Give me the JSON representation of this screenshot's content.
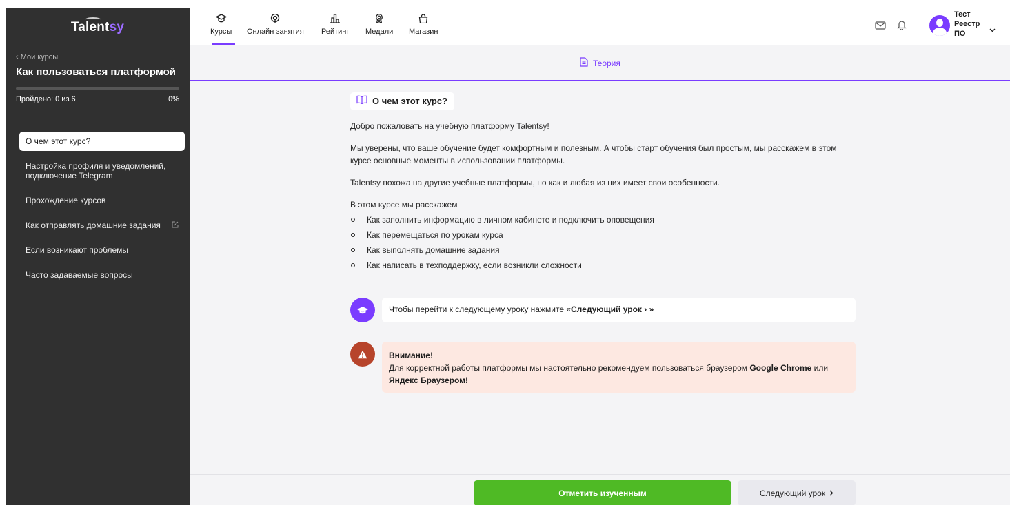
{
  "brand": {
    "logo_main": "Talent",
    "logo_accent": "sy"
  },
  "sidebar": {
    "back_label": "‹ Мои курсы",
    "course_title": "Как пользоваться платформой",
    "progress_label": "Пройдено: 0 из 6",
    "progress_percent_label": "0%",
    "progress_fraction": 0,
    "lessons": [
      {
        "label": "О чем этот курс?",
        "active": true
      },
      {
        "label": "Настройка профиля и уведомлений, подключение Telegram"
      },
      {
        "label": "Прохождение курсов"
      },
      {
        "label": "Как отправлять домашние задания",
        "icon": "edit-icon"
      },
      {
        "label": "Если возникают проблемы"
      },
      {
        "label": "Часто задаваемые вопросы"
      }
    ]
  },
  "nav": {
    "items": [
      {
        "label": "Курсы",
        "icon": "graduation-cap-icon",
        "active": true
      },
      {
        "label": "Онлайн занятия",
        "icon": "broadcast-icon"
      },
      {
        "label": "Рейтинг",
        "icon": "bar-chart-icon"
      },
      {
        "label": "Медали",
        "icon": "medal-icon"
      },
      {
        "label": "Магазин",
        "icon": "shopping-bag-icon"
      }
    ]
  },
  "user": {
    "name_line1": "Тест",
    "name_line2": "Реестр",
    "name_line3": "ПО"
  },
  "tabs": {
    "theory_label": "Теория"
  },
  "lesson": {
    "section_title": "О чем этот курс?",
    "paragraphs": [
      "Добро пожаловать на учебную платформу Talentsy!",
      "Мы уверены, что ваше обучение будет комфортным и полезным. А чтобы старт обучения был простым, мы расскажем в этом курсе основные моменты в использовании платформы.",
      "Talentsy похожа на другие учебные платформы, но как и любая из них имеет свои особенности.",
      "В этом курсе мы расскажем"
    ],
    "bullets": [
      "Как заполнить информацию в личном кабинете и подключить оповещения",
      "Как перемещаться по урокам курса",
      "Как выполнять домашние задания",
      "Как написать в техподдержку, если возникли сложности"
    ],
    "tip_prefix": "Чтобы перейти к следующему уроку нажмите ",
    "tip_bold": "«Следующий урок › »",
    "warning_title": "Внимание!",
    "warning_text_1": "Для корректной работы платформы мы настоятельно рекомендуем пользоваться браузером ",
    "warning_bold_1": "Google Chrome",
    "warning_text_2": " или ",
    "warning_bold_2": "Яндекс Браузером",
    "warning_text_3": "!"
  },
  "footer": {
    "mark_label": "Отметить изученным",
    "next_label": "Следующий урок"
  },
  "colors": {
    "accent": "#7a3cff",
    "success": "#4fba25",
    "warning": "#b7442b",
    "sidebar_bg": "#303030"
  }
}
